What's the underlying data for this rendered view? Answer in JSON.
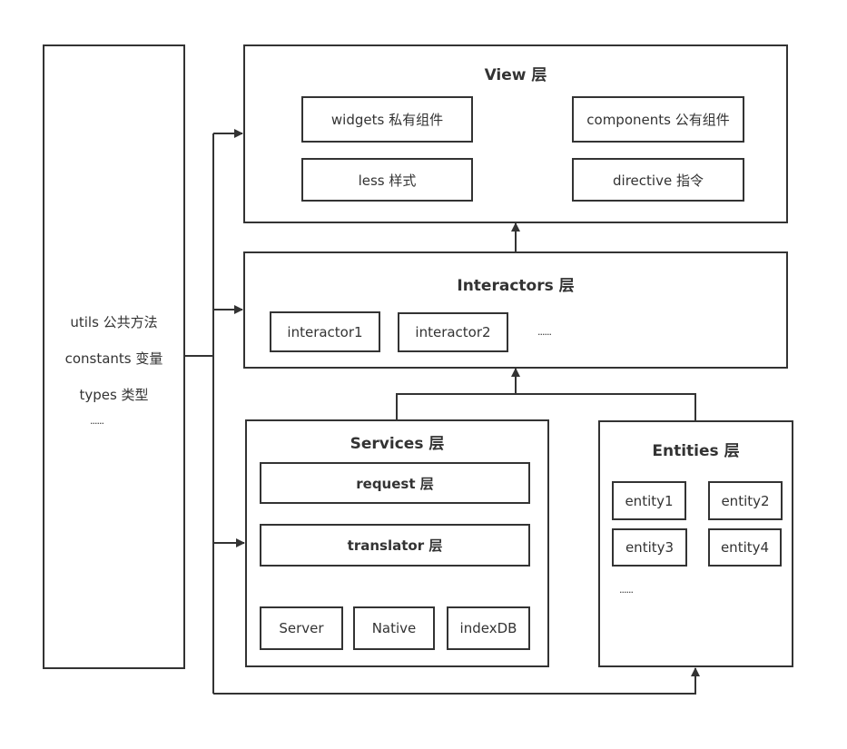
{
  "shared": {
    "items": [
      "utils 公共方法",
      "constants 变量",
      "types 类型",
      "......"
    ]
  },
  "view_layer": {
    "title": "View 层",
    "items": [
      "widgets 私有组件",
      "components 公有组件",
      "less 样式",
      "directive 指令"
    ]
  },
  "interactors_layer": {
    "title": "Interactors 层",
    "items": [
      "interactor1",
      "interactor2"
    ],
    "more": "......"
  },
  "services_layer": {
    "title": "Services 层",
    "request": "request 层",
    "translator": "translator 层",
    "sources": [
      "Server",
      "Native",
      "indexDB"
    ]
  },
  "entities_layer": {
    "title": "Entities 层",
    "items": [
      "entity1",
      "entity2",
      "entity3",
      "entity4"
    ],
    "more": "......"
  },
  "colors": {
    "stroke": "#333333",
    "background": "#ffffff"
  }
}
